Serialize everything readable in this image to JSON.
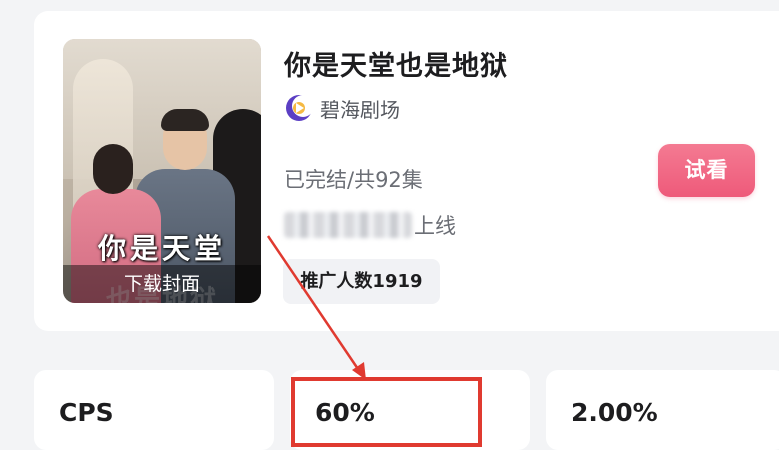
{
  "drama": {
    "title": "你是天堂也是地狱",
    "theater": "碧海剧场",
    "theater_icon": "theater-logo-icon",
    "status": "已完结/共92集",
    "online_suffix": "上线",
    "promo_count_label": "推广人数1919",
    "try_label": "试看"
  },
  "cover": {
    "title_overlay": "你是天堂",
    "subtitle_overlay": "也是地狱",
    "download_label": "下载封面"
  },
  "stats": [
    {
      "value": "CPS"
    },
    {
      "value": "60%"
    },
    {
      "value": "2.00%"
    }
  ],
  "colors": {
    "accent": "#ee5a7a",
    "highlight": "#e03a30",
    "background": "#f3f4f6"
  }
}
